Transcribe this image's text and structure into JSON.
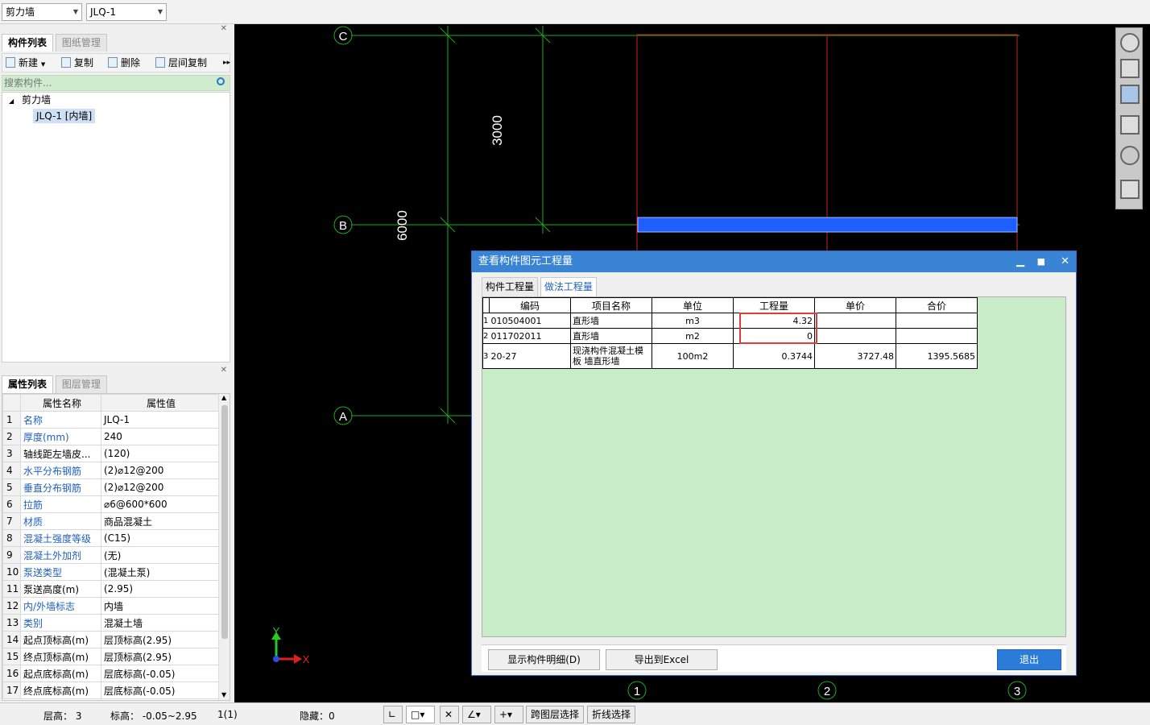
{
  "topbar": {
    "type_combo": "剪力墙",
    "name_combo": "JLQ-1"
  },
  "components_panel": {
    "tabs": [
      "构件列表",
      "图纸管理"
    ],
    "toolbar": {
      "new": "新建",
      "copy": "复制",
      "delete": "删除",
      "floor_copy": "层间复制"
    },
    "search_placeholder": "搜索构件...",
    "tree": {
      "root": "剪力墙",
      "child": "JLQ-1 [内墙]"
    }
  },
  "properties_panel": {
    "tabs": [
      "属性列表",
      "图层管理"
    ],
    "headers": [
      "属性名称",
      "属性值"
    ],
    "rows": [
      {
        "n": "1",
        "name": "名称",
        "value": "JLQ-1"
      },
      {
        "n": "2",
        "name": "厚度(mm)",
        "value": "240"
      },
      {
        "n": "3",
        "name": "轴线距左墙皮...",
        "value": "(120)"
      },
      {
        "n": "4",
        "name": "水平分布钢筋",
        "value": "(2)⌀12@200"
      },
      {
        "n": "5",
        "name": "垂直分布钢筋",
        "value": "(2)⌀12@200"
      },
      {
        "n": "6",
        "name": "拉筋",
        "value": "⌀6@600*600"
      },
      {
        "n": "7",
        "name": "材质",
        "value": "商品混凝土"
      },
      {
        "n": "8",
        "name": "混凝土强度等级",
        "value": "(C15)"
      },
      {
        "n": "9",
        "name": "混凝土外加剂",
        "value": "(无)"
      },
      {
        "n": "10",
        "name": "泵送类型",
        "value": "(混凝土泵)"
      },
      {
        "n": "11",
        "name": "泵送高度(m)",
        "value": "(2.95)"
      },
      {
        "n": "12",
        "name": "内/外墙标志",
        "value": "内墙"
      },
      {
        "n": "13",
        "name": "类别",
        "value": "混凝土墙"
      },
      {
        "n": "14",
        "name": "起点顶标高(m)",
        "value": "层顶标高(2.95)"
      },
      {
        "n": "15",
        "name": "终点顶标高(m)",
        "value": "层顶标高(2.95)"
      },
      {
        "n": "16",
        "name": "起点底标高(m)",
        "value": "层底标高(-0.05)"
      },
      {
        "n": "17",
        "name": "终点底标高(m)",
        "value": "层底标高(-0.05)"
      }
    ]
  },
  "canvas": {
    "axis_labels": {
      "c": "C",
      "b": "B",
      "a": "A",
      "n1": "1",
      "n2": "2",
      "n3": "3"
    },
    "dims": {
      "d3000": "3000",
      "d6000": "6000"
    },
    "coord": {
      "x": "X",
      "y": "Y"
    },
    "colors": {
      "grid": "#1faa1f",
      "wall_outline": "#d01f1f",
      "wall_fill": "#1f5fff"
    }
  },
  "dialog": {
    "title": "查看构件图元工程量",
    "tabs": [
      "构件工程量",
      "做法工程量"
    ],
    "headers": [
      "编码",
      "项目名称",
      "单位",
      "工程量",
      "单价",
      "合价"
    ],
    "rows": [
      {
        "idx": "1",
        "code": "010504001",
        "name": "直形墙",
        "unit": "m3",
        "qty": "4.32",
        "price": "",
        "total": ""
      },
      {
        "idx": "2",
        "code": "011702011",
        "name": "直形墙",
        "unit": "m2",
        "qty": "0",
        "price": "",
        "total": ""
      },
      {
        "idx": "3",
        "code": "20-27",
        "name": "现浇构件混凝土模板 墙直形墙",
        "unit": "100m2",
        "qty": "0.3744",
        "price": "3727.48",
        "total": "1395.5685"
      }
    ],
    "buttons": {
      "detail": "显示构件明细(D)",
      "export": "导出到Excel",
      "exit": "退出"
    }
  },
  "statusbar": {
    "floor_height": "层高： 3",
    "elevation": "标高： -0.05~2.95",
    "count": "1(1)",
    "hidden": "隐藏：0",
    "cross_floor": "跨图层选择",
    "polyline": "折线选择"
  }
}
